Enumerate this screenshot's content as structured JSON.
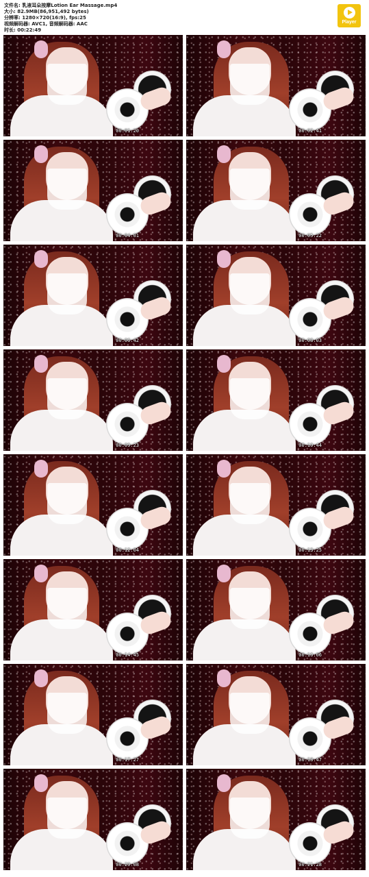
{
  "header": {
    "info_lines": [
      "文件名: 乳液耳朵按摩Lotion Ear Massage.mp4",
      "大小: 82.9MB(86,951,492 bytes)",
      "分辨率: 1280×720(16:9), fps:25",
      "视频解码器: AVC1, 音频解码器: AAC",
      "时长: 00:22:49"
    ],
    "logo_label": "Player",
    "logo_color": "#f2c40f"
  },
  "thumbnails": [
    {
      "timestamp": "00:01:20"
    },
    {
      "timestamp": "00:02:41"
    },
    {
      "timestamp": "00:04:01"
    },
    {
      "timestamp": "00:05:22"
    },
    {
      "timestamp": "00:06:42"
    },
    {
      "timestamp": "00:08:03"
    },
    {
      "timestamp": "00:09:23"
    },
    {
      "timestamp": "00:10:44"
    },
    {
      "timestamp": "00:12:04"
    },
    {
      "timestamp": "00:13:25"
    },
    {
      "timestamp": "00:14:45"
    },
    {
      "timestamp": "00:16:06"
    },
    {
      "timestamp": "00:17:27"
    },
    {
      "timestamp": "00:18:47"
    },
    {
      "timestamp": "00:20:08"
    },
    {
      "timestamp": "00:21:28"
    }
  ]
}
